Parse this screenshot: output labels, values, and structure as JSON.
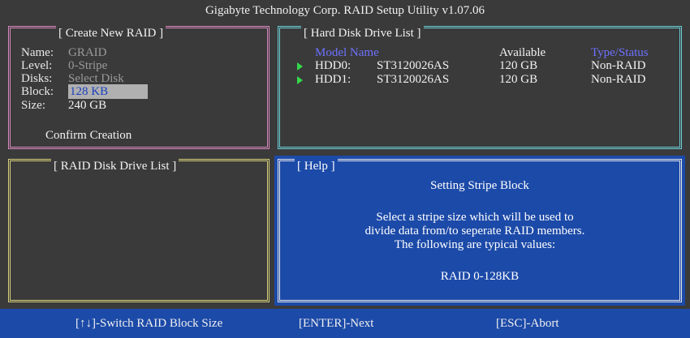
{
  "window": {
    "title": "Gigabyte Technology Corp.  RAID Setup Utility  v1.07.06"
  },
  "create_raid": {
    "title": "[ Create New RAID ]",
    "fields": [
      {
        "label": "Name:",
        "value": "GRAID"
      },
      {
        "label": "Level:",
        "value": "0-Stripe"
      },
      {
        "label": "Disks:",
        "value": "Select Disk"
      },
      {
        "label": "Block:",
        "value": "128 KB"
      },
      {
        "label": "Size:",
        "value": "240 GB"
      }
    ],
    "confirm_label": "Confirm Creation"
  },
  "hdd_list": {
    "title": "[ Hard Disk Drive List ]",
    "headers": {
      "model": "Model Name",
      "available": "Available",
      "type": "Type/Status"
    },
    "rows": [
      {
        "id": "HDD0:",
        "model": "ST3120026AS",
        "available": "120 GB",
        "type": "Non-RAID"
      },
      {
        "id": "HDD1:",
        "model": "ST3120026AS",
        "available": "120 GB",
        "type": "Non-RAID"
      }
    ]
  },
  "raid_list": {
    "title": "[ RAID Disk Drive List ]"
  },
  "help": {
    "title": "[ Help ]",
    "heading": "Setting Stripe Block",
    "lines": [
      "Select a stripe size which will be used to",
      "divide data from/to seperate RAID members.",
      "The following are typical values:"
    ],
    "example": "RAID 0-128KB"
  },
  "footer": {
    "switch": "[↑↓]-Switch RAID Block Size",
    "next": "[ENTER]-Next",
    "abort": "[ESC]-Abort"
  },
  "colors": {
    "create_border": "#d98ac0",
    "hdd_border": "#6bd0d8",
    "raid_border": "#d8d27a",
    "help_bg": "#1c4aa8",
    "highlight_bg": "#b0b0b0",
    "header_blue": "#6e72ff",
    "arrow_green": "#34d94a"
  }
}
